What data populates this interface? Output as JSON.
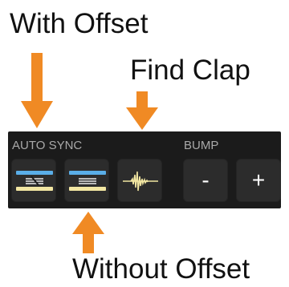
{
  "annotations": {
    "with_offset": "With Offset",
    "find_clap": "Find Clap",
    "without_offset": "Without Offset"
  },
  "panel": {
    "auto_sync_label": "AUTO SYNC",
    "bump_label": "BUMP",
    "bump_minus": "-",
    "bump_plus": "+"
  },
  "colors": {
    "arrow": "#f08a24",
    "panel_bg": "#1b1b1b",
    "button_bg": "#2c2c2c",
    "sync_blue": "#5aaee8",
    "sync_yellow": "#f2e6a2",
    "label_gray": "#a9a9a9"
  },
  "icons": {
    "sync_offset": "sync-offset-icon",
    "sync_no_offset": "sync-no-offset-icon",
    "find_clap": "waveform-icon"
  }
}
